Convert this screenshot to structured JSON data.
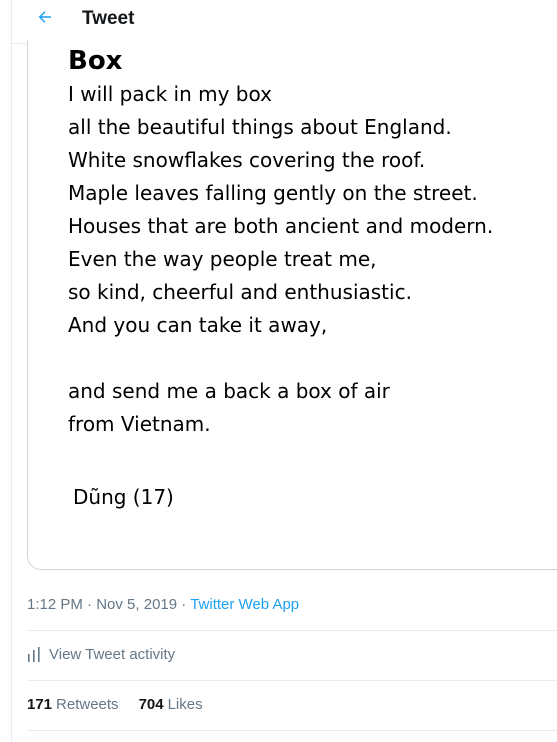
{
  "header": {
    "title": "Tweet",
    "back_icon": "arrow-left-icon",
    "accent_color": "#1da1f2"
  },
  "poem": {
    "title": "Box",
    "lines": [
      "I will pack in my box",
      "all the beautiful things about England.",
      "White snowflakes covering the roof.",
      "Maple leaves falling gently on the street.",
      "Houses that are both ancient and modern.",
      "Even the way people treat me,",
      "so kind, cheerful and enthusiastic.",
      "And you can take it away,",
      "",
      "and send me a back a box of air",
      "from Vietnam."
    ],
    "signature": "Dũng (17)"
  },
  "meta": {
    "time": "1:12 PM",
    "dot1": "·",
    "date": "Nov 5, 2019",
    "dot2": "·",
    "source": "Twitter Web App"
  },
  "activity": {
    "icon": "bar-chart-icon",
    "label": "View Tweet activity"
  },
  "stats": {
    "retweets_count": "171",
    "retweets_label": "Retweets",
    "likes_count": "704",
    "likes_label": "Likes"
  }
}
